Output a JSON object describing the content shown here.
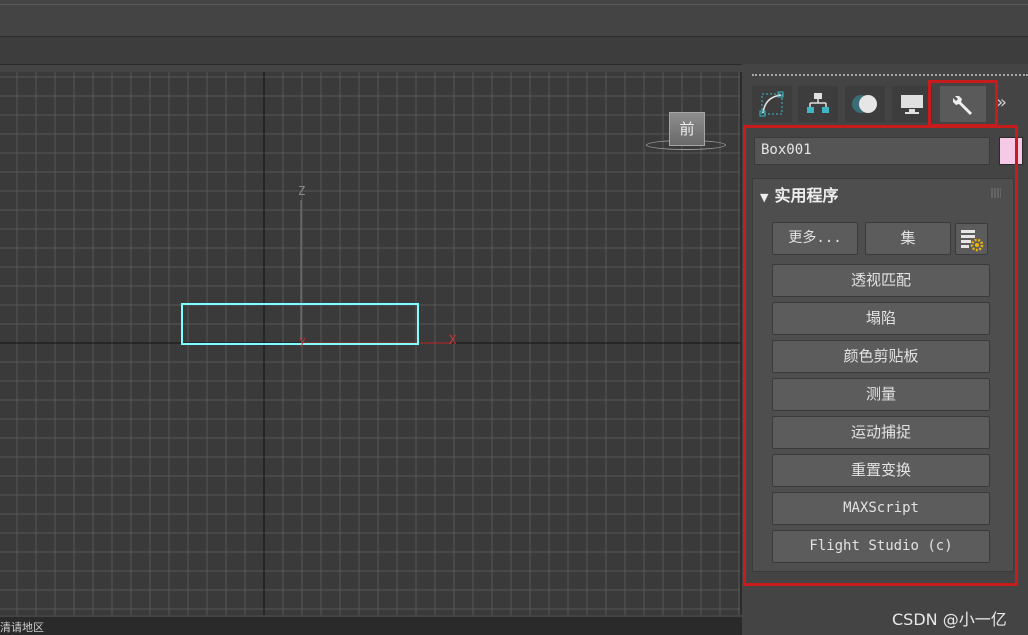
{
  "viewport": {
    "axis_z": "Z",
    "axis_x": "X",
    "axis_y": "y",
    "viewcube_label": "前"
  },
  "status": {
    "text": "清请地区"
  },
  "command_panel": {
    "tabs": [
      {
        "name": "create-tab",
        "icon": "curve-icon"
      },
      {
        "name": "hierarchy-tab",
        "icon": "hierarchy-icon"
      },
      {
        "name": "motion-tab",
        "icon": "circle-icon"
      },
      {
        "name": "display-tab",
        "icon": "monitor-icon"
      },
      {
        "name": "utilities-tab",
        "icon": "wrench-icon",
        "active": true
      }
    ],
    "more_tabs": "»",
    "object_name": "Box001",
    "object_color": "#f6c9e6",
    "rollout": {
      "title": "实用程序",
      "more_label": "更多...",
      "sets_label": "集",
      "config_icon": "configure-sets-icon",
      "buttons": [
        "透视匹配",
        "塌陷",
        "颜色剪贴板",
        "测量",
        "运动捕捉",
        "重置变换",
        "MAXScript",
        "Flight Studio (c)"
      ]
    }
  },
  "watermark": "CSDN @小一亿",
  "colors": {
    "highlight": "#c81c1c",
    "selection": "#7fffff"
  }
}
